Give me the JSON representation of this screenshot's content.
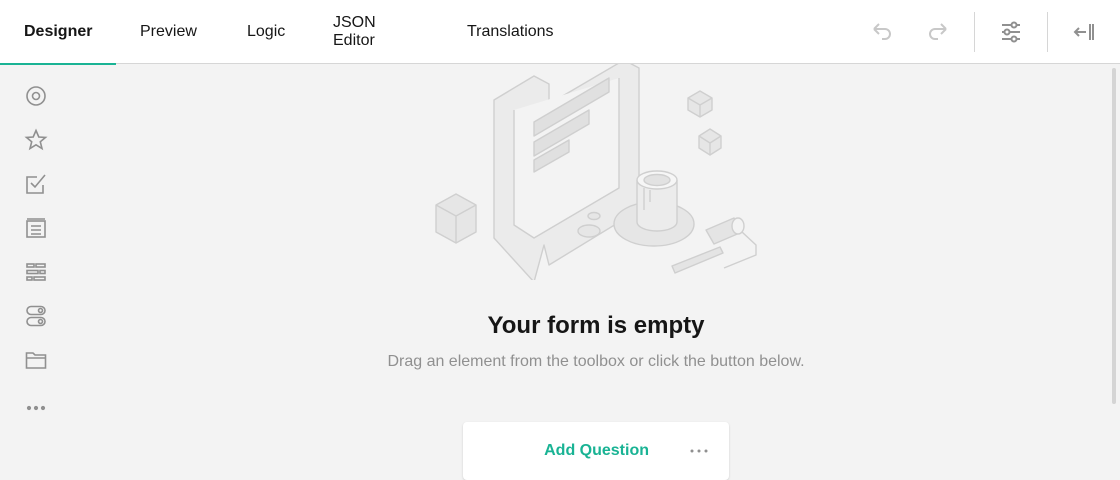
{
  "tabs": [
    {
      "label": "Designer",
      "active": true
    },
    {
      "label": "Preview"
    },
    {
      "label": "Logic"
    },
    {
      "label": "JSON Editor"
    },
    {
      "label": "Translations"
    }
  ],
  "toolbar": {
    "icons": [
      "undo-icon",
      "redo-icon",
      "settings-sliders-icon",
      "collapse-panel-icon"
    ]
  },
  "sidebar": {
    "icons": [
      "radio-icon",
      "star-icon",
      "checkbox-icon",
      "long-text-icon",
      "matrix-icon",
      "toggle-icon",
      "folder-icon",
      "more-icon"
    ]
  },
  "empty": {
    "title": "Your form is empty",
    "subtitle": "Drag an element from the toolbox or click the button below."
  },
  "add_question": {
    "label": "Add Question"
  },
  "colors": {
    "accent": "#19b394",
    "icon": "#909090",
    "background": "#f3f3f3"
  }
}
